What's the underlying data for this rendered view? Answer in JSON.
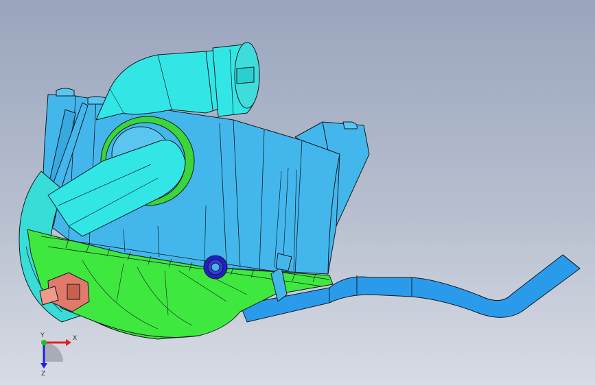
{
  "viewport": {
    "background_top": "#9aa5bd",
    "background_bottom": "#d8dce4"
  },
  "model": {
    "colors": {
      "housing": "#43b7ec",
      "housing_shadow": "#2a8fd0",
      "intake_duct": "#33e6e6",
      "lower_shell": "#3ee83e",
      "lower_shell_dark": "#22b522",
      "hose": "#2a9bea",
      "clamp": "#2020c8",
      "connector": "#e07a6a",
      "edge": "#101820"
    },
    "parts": [
      "filter-housing",
      "intake-duct",
      "lower-shell",
      "outlet-hose",
      "hose-clamp",
      "sensor-connector"
    ]
  },
  "triad": {
    "x_label": "X",
    "y_label": "Y",
    "z_label": "Z",
    "x_color": "#e02020",
    "y_color": "#20c020",
    "z_color": "#2020e0"
  }
}
